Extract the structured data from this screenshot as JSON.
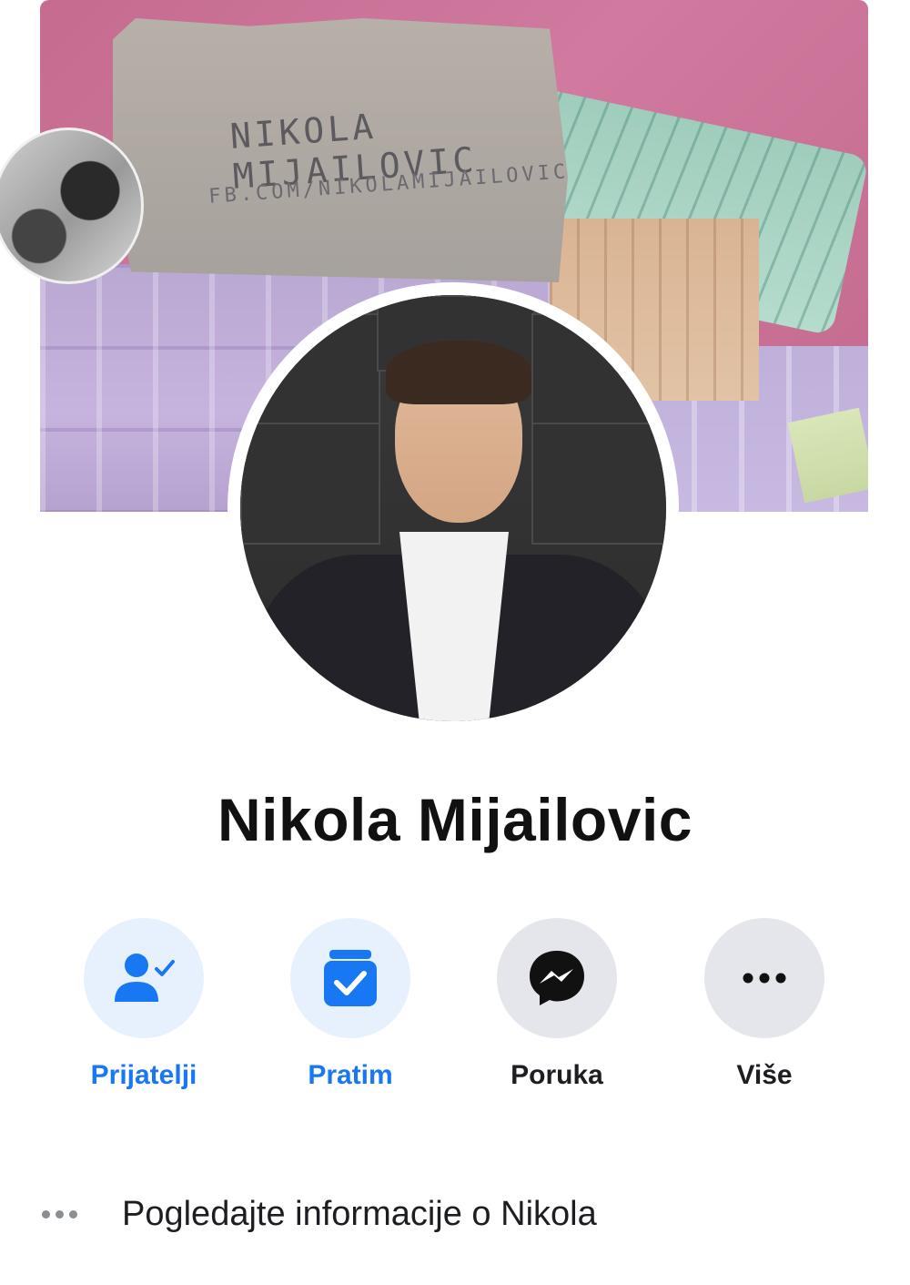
{
  "cover": {
    "handwritten_line_1": "NIKOLA MIJAILOVIC",
    "handwritten_line_2": "FB.COM/NIKOLAMIJAILOVIC"
  },
  "profile": {
    "name": "Nikola Mijailovic"
  },
  "actions": [
    {
      "label": "Prijatelji",
      "icon": "friends-check-icon"
    },
    {
      "label": "Pratim",
      "icon": "following-check-icon"
    },
    {
      "label": "Poruka",
      "icon": "messenger-icon"
    },
    {
      "label": "Više",
      "icon": "more-dots-icon"
    }
  ],
  "info_link": {
    "text": "Pogledajte informacije o Nikola"
  },
  "colors": {
    "accent_blue": "#1877f2",
    "blue_bg": "#e7f1fd",
    "gray_bg": "#e5e6eb"
  }
}
